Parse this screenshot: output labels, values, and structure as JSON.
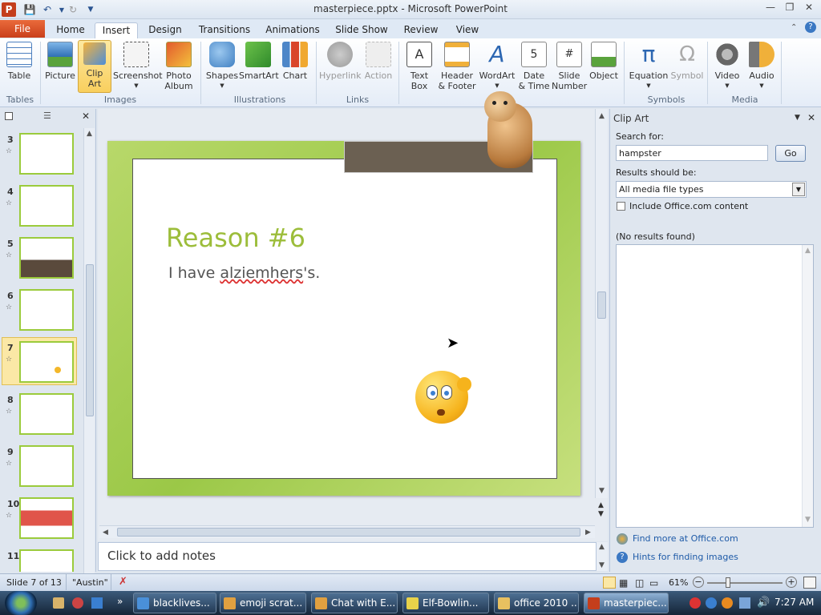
{
  "window": {
    "title": "masterpiece.pptx - Microsoft PowerPoint"
  },
  "tabs": {
    "file": "File",
    "items": [
      "Home",
      "Insert",
      "Design",
      "Transitions",
      "Animations",
      "Slide Show",
      "Review",
      "View"
    ],
    "active": "Insert"
  },
  "ribbon": {
    "buttons": {
      "table": "Table",
      "picture": "Picture",
      "clip_art_1": "Clip",
      "clip_art_2": "Art",
      "screenshot": "Screenshot",
      "photo_album_1": "Photo",
      "photo_album_2": "Album",
      "shapes": "Shapes",
      "smartart": "SmartArt",
      "chart": "Chart",
      "hyperlink": "Hyperlink",
      "action": "Action",
      "text_box_1": "Text",
      "text_box_2": "Box",
      "header_footer_1": "Header",
      "header_footer_2": "& Footer",
      "wordart": "WordArt",
      "date_time_1": "Date",
      "date_time_2": "& Time",
      "slide_number_1": "Slide",
      "slide_number_2": "Number",
      "object": "Object",
      "equation": "Equation",
      "symbol": "Symbol",
      "video": "Video",
      "audio": "Audio"
    },
    "groups": {
      "tables": "Tables",
      "images": "Images",
      "illustrations": "Illustrations",
      "links": "Links",
      "symbols": "Symbols",
      "media": "Media"
    }
  },
  "slides": [
    {
      "num": "3"
    },
    {
      "num": "4"
    },
    {
      "num": "5"
    },
    {
      "num": "6"
    },
    {
      "num": "7"
    },
    {
      "num": "8"
    },
    {
      "num": "9"
    },
    {
      "num": "10"
    },
    {
      "num": "11"
    }
  ],
  "slide": {
    "title": "Reason #6",
    "body_prefix": "I have ",
    "body_misspelled": "alziemhers",
    "body_suffix": "'s."
  },
  "notes": {
    "placeholder": "Click to add notes"
  },
  "clipart_pane": {
    "title": "Clip Art",
    "search_label": "Search for:",
    "search_value": "hampster",
    "go": "Go",
    "results_label": "Results should be:",
    "media_types": "All media file types",
    "include_office": "Include Office.com content",
    "no_results": "(No results found)",
    "find_more": "Find more at Office.com",
    "hints": "Hints for finding images"
  },
  "status": {
    "slide_info": "Slide 7 of 13",
    "theme": "\"Austin\"",
    "zoom": "61%"
  },
  "taskbar": {
    "items": [
      "blacklives...",
      "emoji scrat...",
      "Chat with E...",
      "Elf-Bowlin...",
      "office 2010 ...",
      "masterpiec..."
    ],
    "time": "7:27 AM"
  },
  "colors": {
    "accent": "#9cbd3a",
    "file_tab": "#d9532a",
    "ribbon_bg": "#e4ecf7"
  }
}
